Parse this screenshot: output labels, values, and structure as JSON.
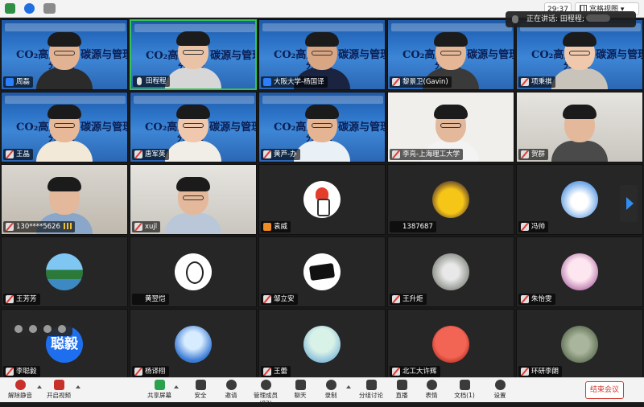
{
  "topbar": {
    "timer": "29:37",
    "view_label": "宫格视图",
    "speaking_label": "正在讲话: 田程程;"
  },
  "slide": {
    "title": "CO₂高质化 / 碳源与管理",
    "subtitle": "分论坛"
  },
  "participants": [
    {
      "name": "周磊",
      "type": "ppt",
      "mic": "host"
    },
    {
      "name": "田程程",
      "type": "ppt",
      "mic": "mic",
      "active": true
    },
    {
      "name": "大阪大学-杨国译",
      "type": "ppt",
      "mic": "host"
    },
    {
      "name": "黎景卫(Gavin)",
      "type": "ppt",
      "mic": "mute"
    },
    {
      "name": "项秉祺",
      "type": "ppt",
      "mic": "mute"
    },
    {
      "name": "王晶",
      "type": "ppt",
      "mic": "mute"
    },
    {
      "name": "唐军英",
      "type": "ppt",
      "mic": "mute"
    },
    {
      "name": "黄芦-办",
      "type": "ppt",
      "mic": "mute"
    },
    {
      "name": "李亮-上海理工大学",
      "type": "video",
      "mic": "mute"
    },
    {
      "name": "贺群",
      "type": "video",
      "mic": "mute"
    },
    {
      "name": "130****5626",
      "type": "video",
      "mic": "mute",
      "signal": true
    },
    {
      "name": "xujl",
      "type": "video",
      "mic": "mute"
    },
    {
      "name": "袁威",
      "type": "avatar",
      "mic": "orange"
    },
    {
      "name": "1387687",
      "type": "avatar",
      "mic": "none"
    },
    {
      "name": "冯帅",
      "type": "avatar",
      "mic": "mute"
    },
    {
      "name": "王芳芳",
      "type": "avatar",
      "mic": "mute"
    },
    {
      "name": "黄翌恺",
      "type": "avatar",
      "mic": "none"
    },
    {
      "name": "邹立安",
      "type": "avatar",
      "mic": "mute"
    },
    {
      "name": "王升炬",
      "type": "avatar",
      "mic": "mute"
    },
    {
      "name": "朱怡雯",
      "type": "avatar",
      "mic": "mute"
    },
    {
      "name": "李聪毅",
      "type": "avatar",
      "mic": "mute",
      "avatar_text": "聪毅"
    },
    {
      "name": "杨译栩",
      "type": "avatar",
      "mic": "mute"
    },
    {
      "name": "王蕾",
      "type": "avatar",
      "mic": "mute"
    },
    {
      "name": "北工大许辉",
      "type": "avatar",
      "mic": "mute"
    },
    {
      "name": "环研李朗",
      "type": "avatar",
      "mic": "mute"
    }
  ],
  "toolbar": {
    "unmute": "解除静音",
    "start_video": "开启视频",
    "share_screen": "共享屏幕",
    "security": "安全",
    "invite": "邀请",
    "manage_members": "管理成员(82)",
    "chat": "聊天",
    "record": "录制",
    "breakout": "分组讨论",
    "live": "直播",
    "reactions": "表情",
    "docs": "文档(1)",
    "settings": "设置",
    "end_meeting": "结束会议"
  }
}
